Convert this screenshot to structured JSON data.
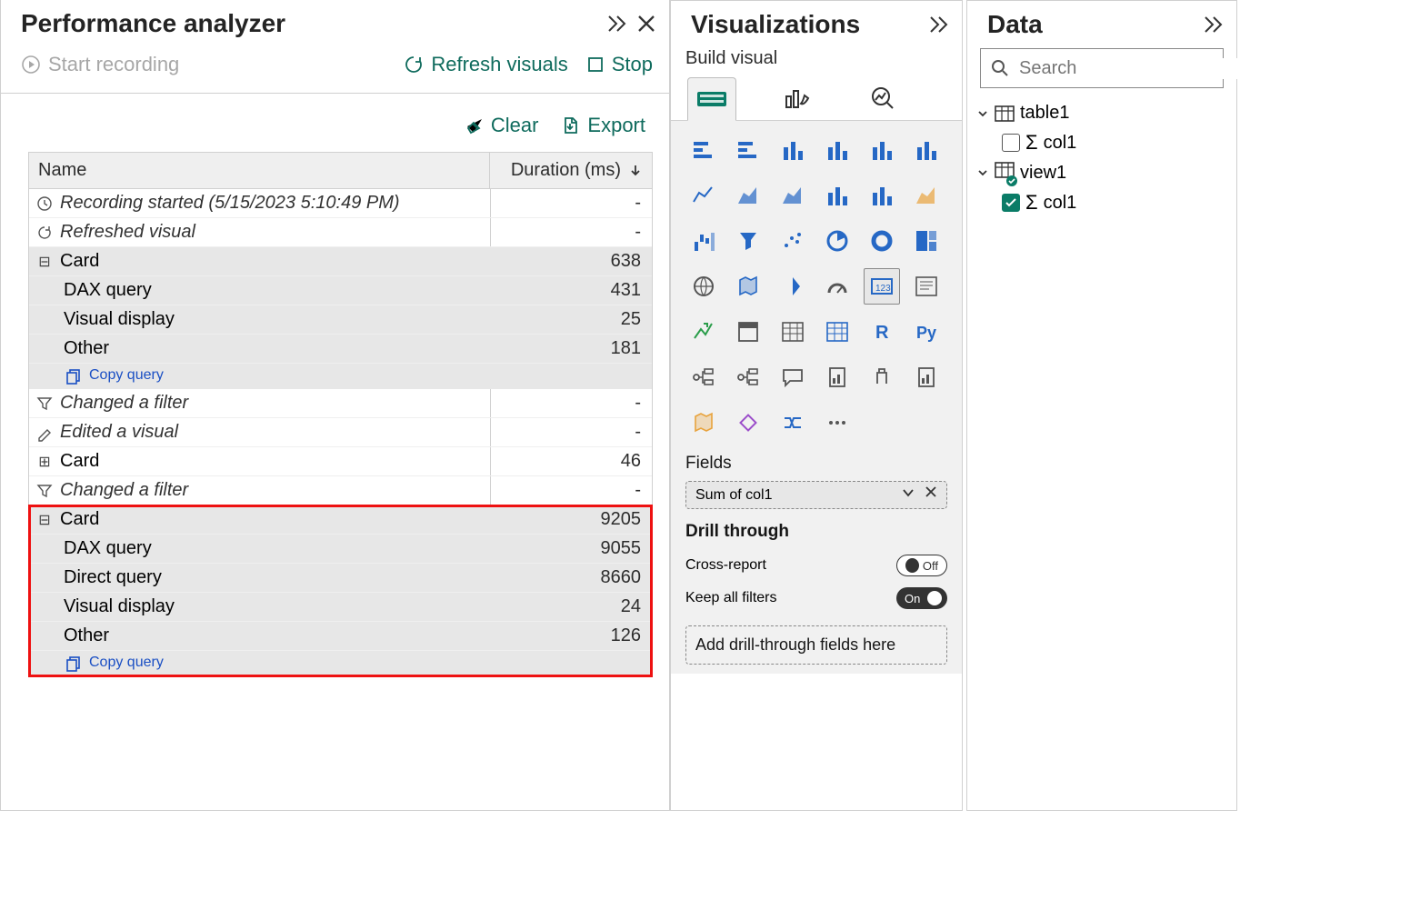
{
  "perf": {
    "title": "Performance analyzer",
    "start_recording": "Start recording",
    "refresh": "Refresh visuals",
    "stop": "Stop",
    "clear": "Clear",
    "export": "Export",
    "col_name": "Name",
    "col_duration": "Duration (ms)",
    "copy_query": "Copy query",
    "rows": {
      "rec_started": "Recording started (5/15/2023 5:10:49 PM)",
      "refreshed": "Refreshed visual",
      "card1": "Card",
      "card1_dur": "638",
      "dax1": "DAX query",
      "dax1_dur": "431",
      "vis1": "Visual display",
      "vis1_dur": "25",
      "oth1": "Other",
      "oth1_dur": "181",
      "chg_filter1": "Changed a filter",
      "edited": "Edited a visual",
      "card2": "Card",
      "card2_dur": "46",
      "chg_filter2": "Changed a filter",
      "card3": "Card",
      "card3_dur": "9205",
      "dax3": "DAX query",
      "dax3_dur": "9055",
      "dq3": "Direct query",
      "dq3_dur": "8660",
      "vis3": "Visual display",
      "vis3_dur": "24",
      "oth3": "Other",
      "oth3_dur": "126"
    }
  },
  "viz": {
    "title": "Visualizations",
    "build": "Build visual",
    "fields": "Fields",
    "field_sum": "Sum of col1",
    "drill": "Drill through",
    "cross": "Cross-report",
    "keep": "Keep all filters",
    "off": "Off",
    "on": "On",
    "drop": "Add drill-through fields here",
    "icon_labels": [
      "stacked-bar",
      "clustered-bar",
      "stacked-column",
      "clustered-column",
      "100-stacked-bar",
      "100-stacked-column",
      "line",
      "area",
      "stacked-area",
      "line-clustered-column",
      "line-stacked-column",
      "ribbon",
      "waterfall",
      "funnel",
      "scatter",
      "pie",
      "donut",
      "treemap",
      "map",
      "filled-map",
      "azure-map",
      "gauge",
      "card",
      "multi-row-card",
      "kpi",
      "slicer",
      "table",
      "matrix",
      "r-visual",
      "python-visual",
      "key-influencers",
      "decomposition-tree",
      "qna",
      "narrative",
      "goals",
      "paginated",
      "arcgis",
      "powerapps",
      "power-automate",
      "more"
    ]
  },
  "data": {
    "title": "Data",
    "search_ph": "Search",
    "table1": "table1",
    "col1": "col1",
    "view1": "view1",
    "col1b": "col1"
  }
}
